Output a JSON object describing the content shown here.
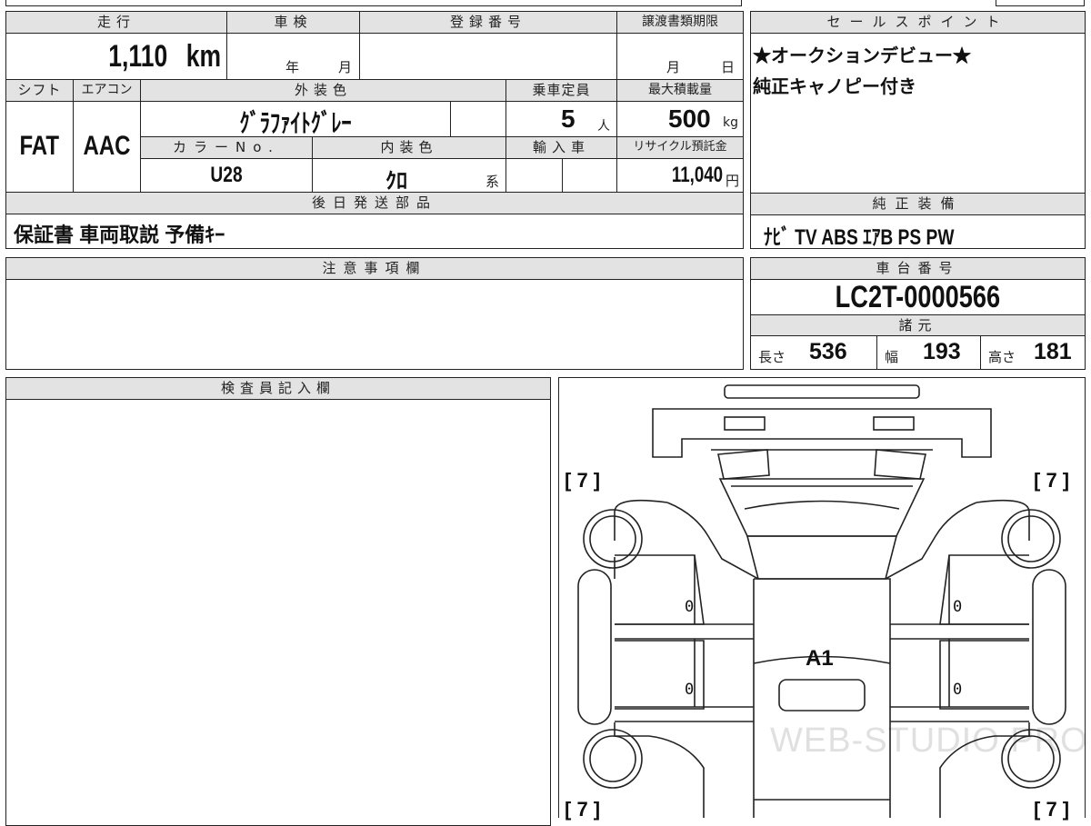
{
  "top_table": {
    "mileage": {
      "label": "走行",
      "value": "1,110",
      "unit": "km"
    },
    "shaken": {
      "label": "車検",
      "year_unit": "年",
      "month_unit": "月"
    },
    "registration": {
      "label": "登録番号",
      "value": ""
    },
    "transfer_deadline": {
      "label": "譲渡書類期限",
      "month_unit": "月",
      "day_unit": "日"
    },
    "shift": {
      "label": "シフト",
      "value": "FAT"
    },
    "aircon": {
      "label": "エアコン",
      "value": "AAC"
    },
    "exterior_color": {
      "label": "外装色",
      "value": "ｸﾞﾗﾌｧｲﾄｸﾞﾚｰ"
    },
    "capacity": {
      "label": "乗車定員",
      "value": "5",
      "unit": "人"
    },
    "max_load": {
      "label": "最大積載量",
      "value": "500",
      "unit": "kg"
    },
    "color_no": {
      "label": "カラーNo.",
      "value": "U28"
    },
    "interior_color": {
      "label": "内装色",
      "value": "ｸﾛ",
      "suffix": "系"
    },
    "import": {
      "label": "輸入車",
      "value": ""
    },
    "recycle": {
      "label": "リサイクル預託金",
      "value": "11,040",
      "unit": "円"
    },
    "later_parts": {
      "label": "後日発送部品",
      "value": "保証書 車両取説 予備ｷｰ"
    }
  },
  "sales_point": {
    "label": "セールスポイント",
    "lines": [
      "★オークションデビュー★",
      "純正キャノピー付き"
    ]
  },
  "standard_equipment": {
    "label": "純正装備",
    "value": "ﾅﾋﾞ TV ABS ｴｱB PS PW"
  },
  "notes": {
    "label": "注意事項欄",
    "value": ""
  },
  "chassis": {
    "label": "車台番号",
    "value": "LC2T-0000566"
  },
  "specs": {
    "label": "諸元",
    "length_label": "長さ",
    "length": "536",
    "width_label": "幅",
    "width": "193",
    "height_label": "高さ",
    "height": "181"
  },
  "inspector": {
    "label": "検査員記入欄",
    "value": ""
  },
  "diagram": {
    "corner_markers": [
      "[ 7 ]",
      "[ 7 ]",
      "[ 7 ]",
      "[ 7 ]"
    ],
    "panel_marks": [
      "0",
      "0",
      "0",
      "0"
    ],
    "damage_code": "A1",
    "watermark": "WEB-STUDIO.PRO"
  }
}
